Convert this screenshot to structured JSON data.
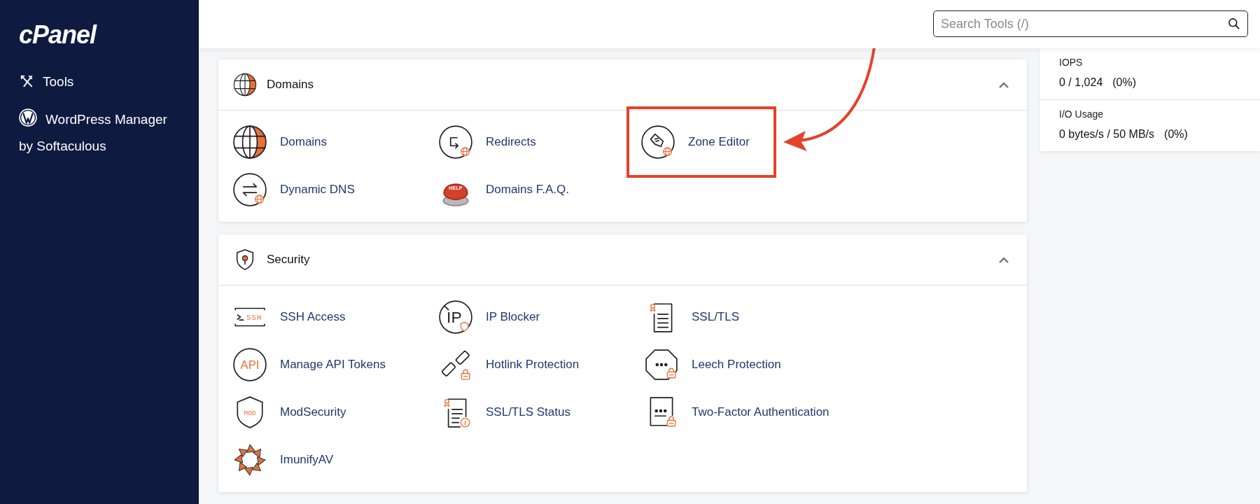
{
  "sidebar": {
    "logo": "cPanel",
    "items": [
      {
        "label": "Tools"
      },
      {
        "label": "WordPress Manager by Softaculous"
      }
    ]
  },
  "search": {
    "placeholder": "Search Tools (/)"
  },
  "sections": [
    {
      "title": "Domains",
      "expanded": true,
      "items": [
        {
          "label": "Domains",
          "highlighted": false
        },
        {
          "label": "Redirects",
          "highlighted": false
        },
        {
          "label": "Zone Editor",
          "highlighted": true
        },
        {
          "label": "Dynamic DNS",
          "highlighted": false
        },
        {
          "label": "Domains F.A.Q.",
          "highlighted": false,
          "icon_text": "HELP"
        }
      ]
    },
    {
      "title": "Security",
      "expanded": true,
      "items": [
        {
          "label": "SSH Access",
          "highlighted": false,
          "icon_text": "SSH"
        },
        {
          "label": "IP Blocker",
          "highlighted": false,
          "icon_text": "IP"
        },
        {
          "label": "SSL/TLS",
          "highlighted": false
        },
        {
          "label": "Manage API Tokens",
          "highlighted": false,
          "icon_text": "API"
        },
        {
          "label": "Hotlink Protection",
          "highlighted": false
        },
        {
          "label": "Leech Protection",
          "highlighted": false
        },
        {
          "label": "ModSecurity",
          "highlighted": false,
          "icon_text": "MOD"
        },
        {
          "label": "SSL/TLS Status",
          "highlighted": false
        },
        {
          "label": "Two-Factor Authentication",
          "highlighted": false
        },
        {
          "label": "ImunifyAV",
          "highlighted": false
        }
      ]
    }
  ],
  "stats": [
    {
      "label": "IOPS",
      "value": "0 / 1,024",
      "percent": "(0%)"
    },
    {
      "label": "I/O Usage",
      "value": "0 bytes/s / 50 MB/s",
      "percent": "(0%)"
    }
  ]
}
